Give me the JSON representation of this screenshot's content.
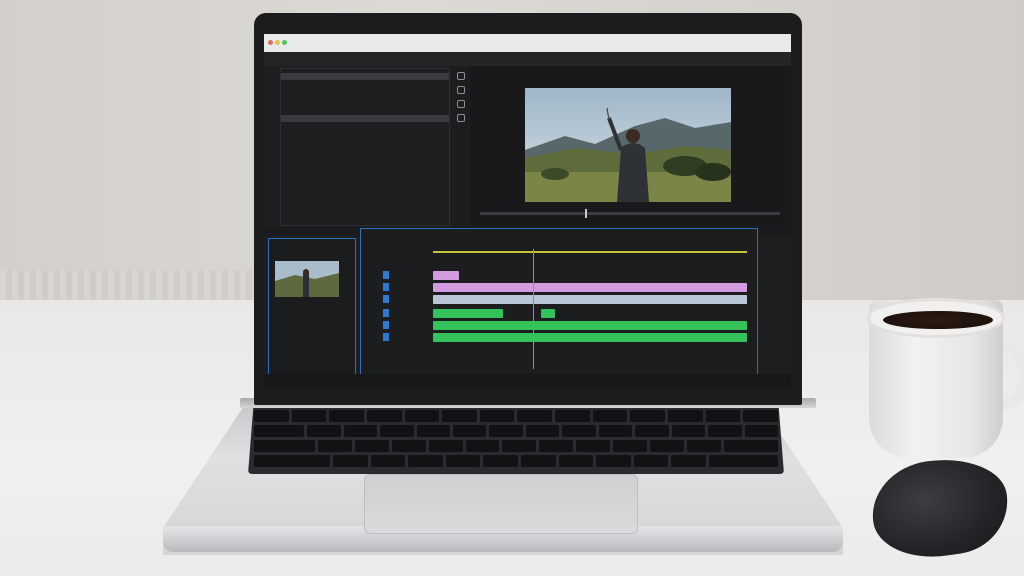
{
  "photo": {
    "setting": "desk",
    "colors": {
      "desk": "#f1f0ee",
      "wall": "#d8d5d1",
      "laptop_body": "#d4d5d7",
      "bezel": "#1b1c1e",
      "mug": "#f1f0ee",
      "coffee": "#1a0f0a",
      "mouse": "#232427"
    }
  },
  "editor": {
    "titlebar": {
      "text": ""
    },
    "project_panel": {
      "header": "",
      "items": [
        {
          "label": "",
          "selected": true
        },
        {
          "label": "",
          "selected": false
        },
        {
          "label": "",
          "selected": false
        },
        {
          "label": "",
          "selected": false
        },
        {
          "label": "",
          "selected": false
        },
        {
          "label": "",
          "selected": false
        },
        {
          "label": "",
          "selected": true
        },
        {
          "label": "",
          "selected": false
        },
        {
          "label": "",
          "selected": false
        }
      ]
    },
    "program_monitor": {
      "header": "",
      "scrub_fraction": 0.35
    },
    "timeline": {
      "tick_labels": [
        "",
        "",
        "",
        "",
        "",
        "",
        ""
      ],
      "playhead_fraction": 0.32,
      "colors": {
        "video_clip": "#d59be0",
        "audio_clip": "#34c35a",
        "selection": "#2a6fc4",
        "work_area": "#c8c43a"
      }
    },
    "source_panel": {
      "header": ""
    },
    "footer": {
      "label": ""
    }
  }
}
